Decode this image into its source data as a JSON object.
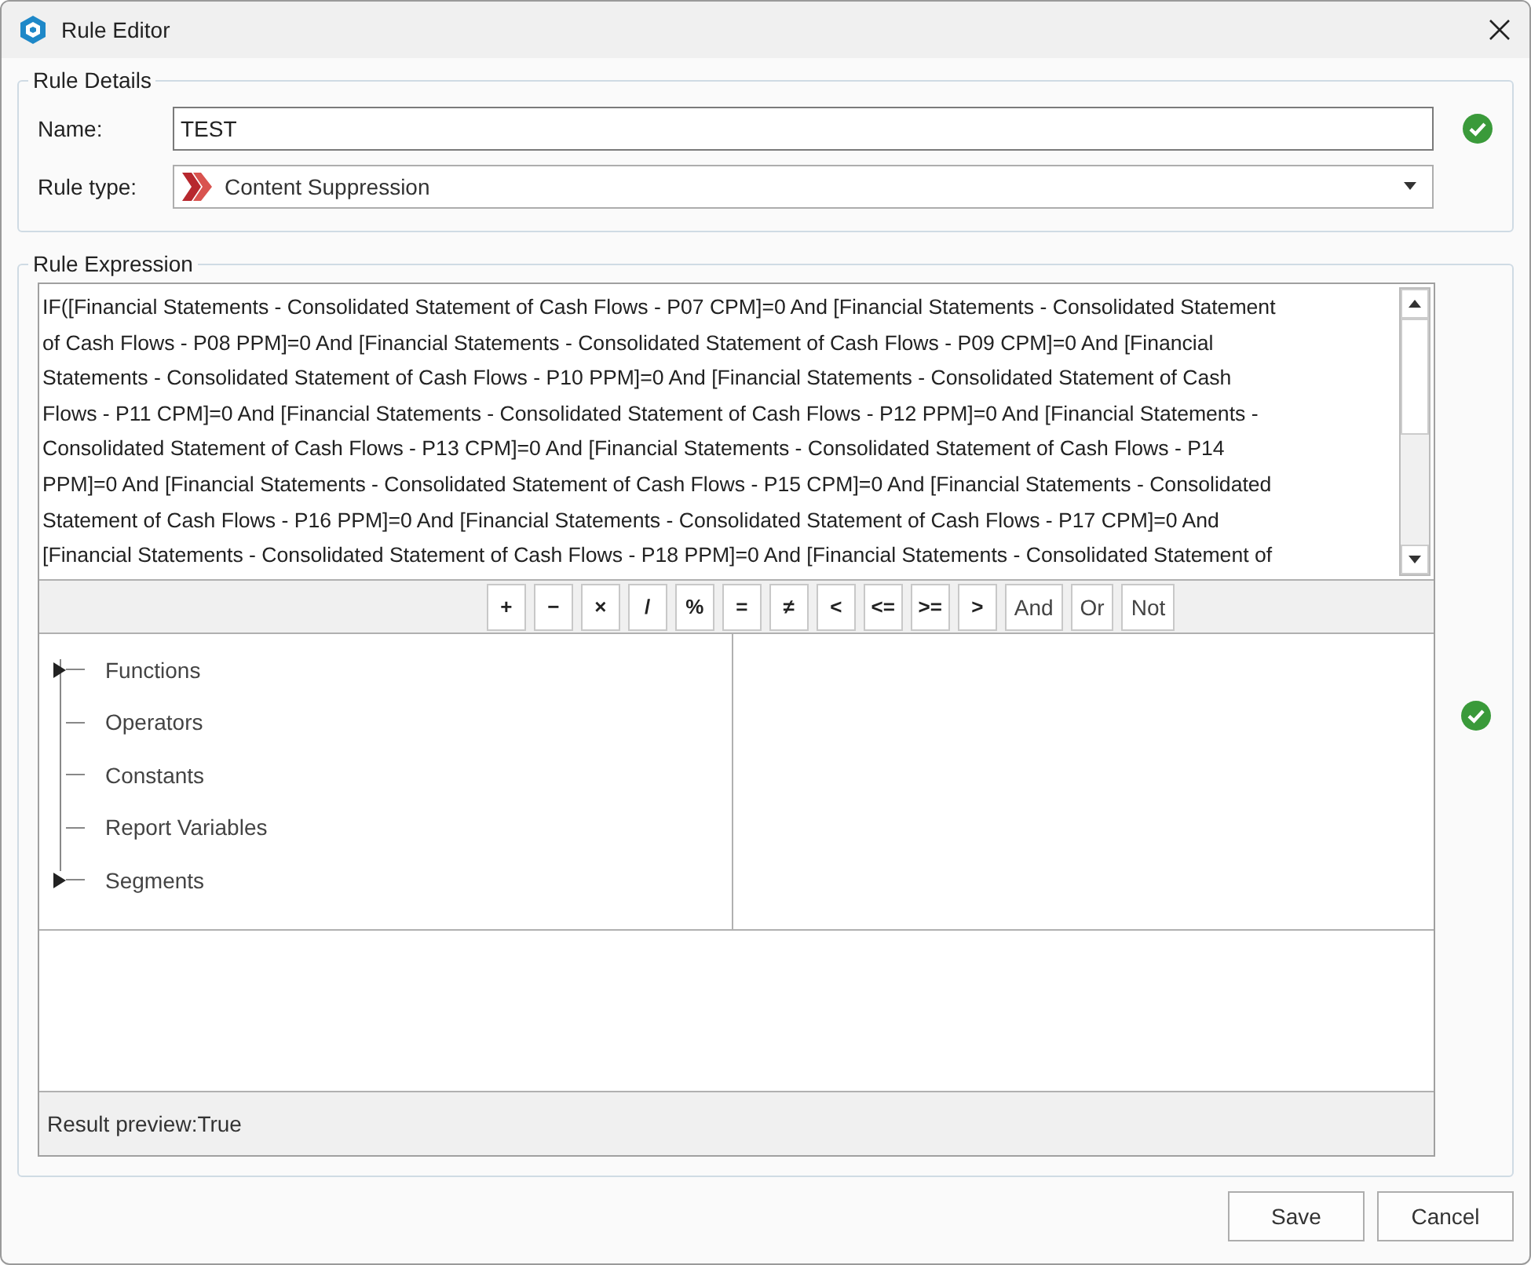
{
  "window": {
    "title": "Rule Editor"
  },
  "rule_details": {
    "legend": "Rule Details",
    "name_label": "Name:",
    "name_value": "TEST",
    "name_valid": true,
    "type_label": "Rule type:",
    "type_value": "Content Suppression"
  },
  "rule_expression": {
    "legend": "Rule Expression",
    "valid": true,
    "lines": [
      "IF([Financial Statements - Consolidated Statement of Cash Flows - P07 CPM]=0 And [Financial Statements - Consolidated Statement",
      "of Cash Flows - P08 PPM]=0 And [Financial Statements - Consolidated Statement of Cash Flows - P09 CPM]=0 And [Financial",
      "Statements - Consolidated Statement of Cash Flows - P10 PPM]=0 And [Financial Statements - Consolidated Statement of Cash",
      "Flows - P11 CPM]=0 And [Financial Statements - Consolidated Statement of Cash Flows - P12 PPM]=0 And [Financial Statements -",
      "Consolidated Statement of Cash Flows - P13 CPM]=0 And [Financial Statements - Consolidated Statement of Cash Flows - P14",
      "PPM]=0 And [Financial Statements - Consolidated Statement of Cash Flows - P15 CPM]=0 And [Financial Statements - Consolidated",
      "Statement of Cash Flows - P16 PPM]=0 And [Financial Statements - Consolidated Statement of Cash Flows - P17 CPM]=0 And",
      "[Financial Statements - Consolidated Statement of Cash Flows - P18 PPM]=0 And [Financial Statements - Consolidated Statement of"
    ],
    "operators": [
      {
        "label": "+",
        "kind": "symbol"
      },
      {
        "label": "−",
        "kind": "symbol"
      },
      {
        "label": "×",
        "kind": "symbol"
      },
      {
        "label": "/",
        "kind": "symbol"
      },
      {
        "label": "%",
        "kind": "symbol"
      },
      {
        "label": "=",
        "kind": "symbol"
      },
      {
        "label": "≠",
        "kind": "symbol"
      },
      {
        "label": "<",
        "kind": "symbol"
      },
      {
        "label": "<=",
        "kind": "symbol"
      },
      {
        "label": ">=",
        "kind": "symbol"
      },
      {
        "label": ">",
        "kind": "symbol"
      },
      {
        "label": "And",
        "kind": "word"
      },
      {
        "label": "Or",
        "kind": "word"
      },
      {
        "label": "Not",
        "kind": "word"
      }
    ],
    "tree": [
      {
        "label": "Functions",
        "kind": "folder"
      },
      {
        "label": "Operators",
        "kind": "leaf"
      },
      {
        "label": "Constants",
        "kind": "leaf"
      },
      {
        "label": "Report Variables",
        "kind": "leaf"
      },
      {
        "label": "Segments",
        "kind": "folder"
      }
    ],
    "result_preview": "Result preview:True"
  },
  "buttons": [
    "Save",
    "Cancel"
  ]
}
